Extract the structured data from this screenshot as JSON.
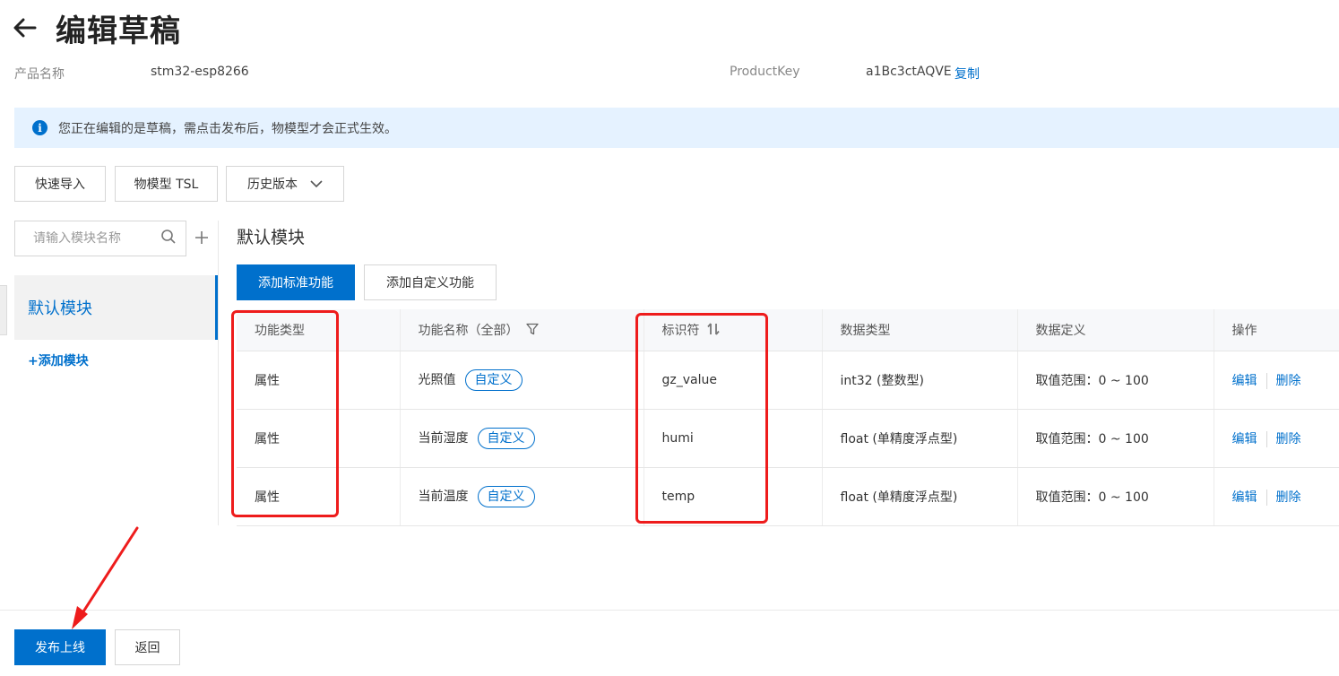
{
  "header": {
    "title": "编辑草稿"
  },
  "product": {
    "name_label": "产品名称",
    "name_value": "stm32-esp8266",
    "key_label": "ProductKey",
    "key_value": "a1Bc3ctAQVE",
    "copy_label": "复制"
  },
  "notice": {
    "text": "您正在编辑的是草稿，需点击发布后，物模型才会正式生效。"
  },
  "toolbar": {
    "quick_import": "快速导入",
    "tsl": "物模型 TSL",
    "history": "历史版本"
  },
  "sidebar": {
    "search_placeholder": "请输入模块名称",
    "active_module": "默认模块",
    "add_module": "+添加模块"
  },
  "main": {
    "section_title": "默认模块",
    "add_standard": "添加标准功能",
    "add_custom": "添加自定义功能"
  },
  "table": {
    "columns": [
      "功能类型",
      "功能名称（全部）",
      "标识符",
      "数据类型",
      "数据定义",
      "操作"
    ],
    "rows": [
      {
        "type": "属性",
        "name": "光照值",
        "tag": "自定义",
        "identifier": "gz_value",
        "data_type": "int32 (整数型)",
        "definition": "取值范围：0 ~ 100",
        "edit": "编辑",
        "delete": "删除"
      },
      {
        "type": "属性",
        "name": "当前湿度",
        "tag": "自定义",
        "identifier": "humi",
        "data_type": "float (单精度浮点型)",
        "definition": "取值范围：0 ~ 100",
        "edit": "编辑",
        "delete": "删除"
      },
      {
        "type": "属性",
        "name": "当前温度",
        "tag": "自定义",
        "identifier": "temp",
        "data_type": "float (单精度浮点型)",
        "definition": "取值范围：0 ~ 100",
        "edit": "编辑",
        "delete": "删除"
      }
    ]
  },
  "footer": {
    "publish": "发布上线",
    "back": "返回"
  },
  "colors": {
    "primary": "#0070cc",
    "notice_bg": "#e5f2ff",
    "annotation_red": "#ee1c1c"
  },
  "icons": [
    "back-arrow-icon",
    "info-icon",
    "chevron-down-icon",
    "search-icon",
    "plus-icon",
    "filter-icon",
    "sort-icon"
  ]
}
